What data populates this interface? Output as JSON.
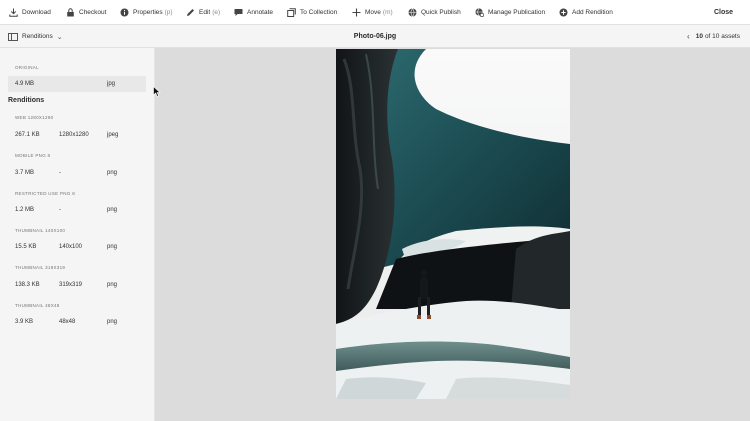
{
  "toolbar": {
    "actions": [
      {
        "label": "Download",
        "icon": "download-icon"
      },
      {
        "label": "Checkout",
        "icon": "lock-icon"
      },
      {
        "label": "Properties",
        "shortcut": "(p)",
        "icon": "info-icon"
      },
      {
        "label": "Edit",
        "shortcut": "(e)",
        "icon": "pencil-icon"
      },
      {
        "label": "Annotate",
        "icon": "comment-icon"
      },
      {
        "label": "To Collection",
        "icon": "collection-icon"
      },
      {
        "label": "Move",
        "shortcut": "(m)",
        "icon": "move-icon"
      },
      {
        "label": "Quick Publish",
        "icon": "globe-icon"
      },
      {
        "label": "Manage Publication",
        "icon": "globe-gear-icon"
      },
      {
        "label": "Add Rendition",
        "icon": "add-circle-icon"
      }
    ],
    "close_label": "Close"
  },
  "subheader": {
    "rail_label": "Renditions",
    "title": "Photo-06.jpg",
    "pager_current": "10",
    "pager_text": "of 10 assets"
  },
  "rail": {
    "original_label": "ORIGINAL",
    "original": {
      "size": "4.9 MB",
      "dims": "",
      "format": "jpg"
    },
    "renditions_heading": "Renditions",
    "items": [
      {
        "label": "WEB 1280X1280",
        "size": "267.1 KB",
        "dims": "1280x1280",
        "format": "jpeg"
      },
      {
        "label": "MOBILE PNG 8",
        "size": "3.7 MB",
        "dims": "-",
        "format": "png"
      },
      {
        "label": "RESTRICTED USE PNG 8",
        "size": "1.2 MB",
        "dims": "-",
        "format": "png"
      },
      {
        "label": "THUMBNAIL 140X100",
        "size": "15.5 KB",
        "dims": "140x100",
        "format": "png"
      },
      {
        "label": "THUMBNAIL 319X319",
        "size": "138.3 KB",
        "dims": "319x319",
        "format": "png"
      },
      {
        "label": "THUMBNAIL 48X48",
        "size": "3.9 KB",
        "dims": "48x48",
        "format": "png"
      }
    ]
  },
  "colors": {
    "rail_bg": "#f5f5f5",
    "stage_bg": "#dcdcdc",
    "selected_row": "#e8e8e8",
    "ice_teal": "#1f5a60",
    "snow": "#f0f3f4"
  }
}
